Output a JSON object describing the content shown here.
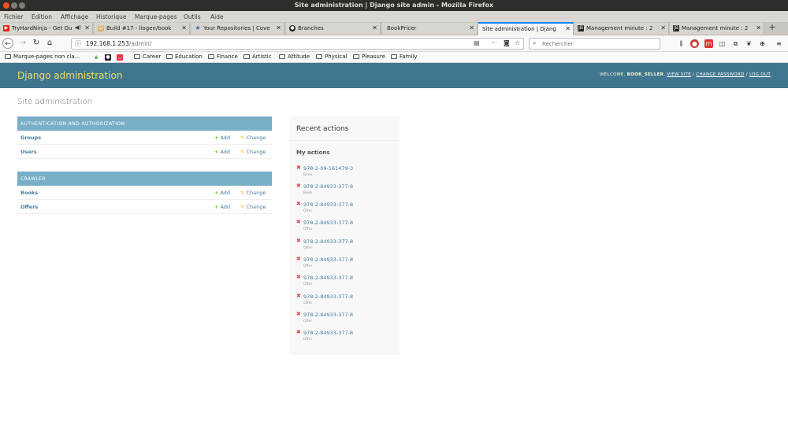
{
  "window": {
    "title": "Site administration | Django site admin - Mozilla Firefox"
  },
  "menu": [
    "Fichier",
    "Édition",
    "Affichage",
    "Historique",
    "Marque-pages",
    "Outils",
    "Aide"
  ],
  "tabs": [
    {
      "label": "TryHardNinja - Get Ou",
      "favicon_color": "#e62117"
    },
    {
      "label": "Build #17 - liogen/book",
      "favicon_color": "#d7b46a"
    },
    {
      "label": "Your Repositories | Cove",
      "favicon_color": "#2f6fb3"
    },
    {
      "label": "Branches",
      "favicon_color": "#222222"
    },
    {
      "label": "BookPricer",
      "favicon_color": "#cccccc"
    },
    {
      "label": "Site administration | Djang",
      "favicon_color": "#cccccc"
    },
    {
      "label": "Management minute : 2",
      "favicon_color": "#222222"
    },
    {
      "label": "Management minute : 2",
      "favicon_color": "#222222"
    }
  ],
  "nav": {
    "url_host": "192.168.1.253",
    "url_path": "/admin/",
    "search_placeholder": "Rechercher"
  },
  "bookmarks": {
    "first": "Marque-pages non cla...",
    "folders": [
      "Career",
      "Education",
      "Finance",
      "Artistic",
      "Attitude",
      "Physical",
      "Pleasure",
      "Family"
    ]
  },
  "django": {
    "branding": "Django administration",
    "welcome": "WELCOME,",
    "username": "BOOK_SELLER",
    "view_site": "VIEW SITE",
    "change_password": "CHANGE PASSWORD",
    "log_out": "LOG OUT",
    "sep": "/"
  },
  "content": {
    "title": "Site administration",
    "add_label": "Add",
    "change_label": "Change",
    "modules": [
      {
        "caption": "AUTHENTICATION AND AUTHORIZATION",
        "models": [
          "Groups",
          "Users"
        ]
      },
      {
        "caption": "CRAWLER",
        "models": [
          "Books",
          "Offers"
        ]
      }
    ]
  },
  "recent": {
    "title": "Recent actions",
    "subtitle": "My actions",
    "actions": [
      {
        "name": "978-2-09-161479-3",
        "type": "Book"
      },
      {
        "name": "978-2-84933-377-8",
        "type": "Book"
      },
      {
        "name": "978-2-84933-377-8",
        "type": "Offer"
      },
      {
        "name": "978-2-84933-377-8",
        "type": "Offer"
      },
      {
        "name": "978-2-84933-377-8",
        "type": "Offer"
      },
      {
        "name": "978-2-84933-377-8",
        "type": "Offer"
      },
      {
        "name": "978-2-84933-377-8",
        "type": "Offer"
      },
      {
        "name": "978-2-84933-377-8",
        "type": "Offer"
      },
      {
        "name": "978-2-84933-377-8",
        "type": "Offer"
      },
      {
        "name": "978-2-84933-377-8",
        "type": "Offer"
      }
    ]
  },
  "colors": {
    "django_header": "#417690",
    "branding": "#f5dd5d",
    "module_caption": "#79aec8",
    "link": "#447e9b",
    "delete": "#dd4646",
    "add": "#70bf2b"
  }
}
